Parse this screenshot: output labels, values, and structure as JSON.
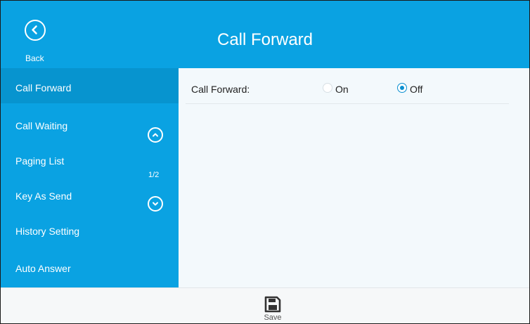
{
  "header": {
    "back_label": "Back",
    "title": "Call Forward"
  },
  "sidebar": {
    "items": [
      {
        "label": "Call Forward",
        "active": true
      },
      {
        "label": "Call Waiting",
        "active": false
      },
      {
        "label": "Paging List",
        "active": false
      },
      {
        "label": "Key As Send",
        "active": false
      },
      {
        "label": "History Setting",
        "active": false
      },
      {
        "label": "Auto Answer",
        "active": false
      }
    ],
    "page_indicator": "1/2",
    "scroll_up_icon": "chevron-up-circle-icon",
    "scroll_down_icon": "chevron-down-circle-icon"
  },
  "content": {
    "call_forward_label": "Call Forward:",
    "options": [
      {
        "label": "On",
        "selected": false
      },
      {
        "label": "Off",
        "selected": true
      }
    ]
  },
  "footer": {
    "save_label": "Save",
    "save_icon": "floppy-disk-icon"
  },
  "colors": {
    "accent": "#0aa2e2",
    "active_item": "#0794cf",
    "content_bg": "#f3f9fc",
    "radio_selected": "#0a8fd0"
  }
}
